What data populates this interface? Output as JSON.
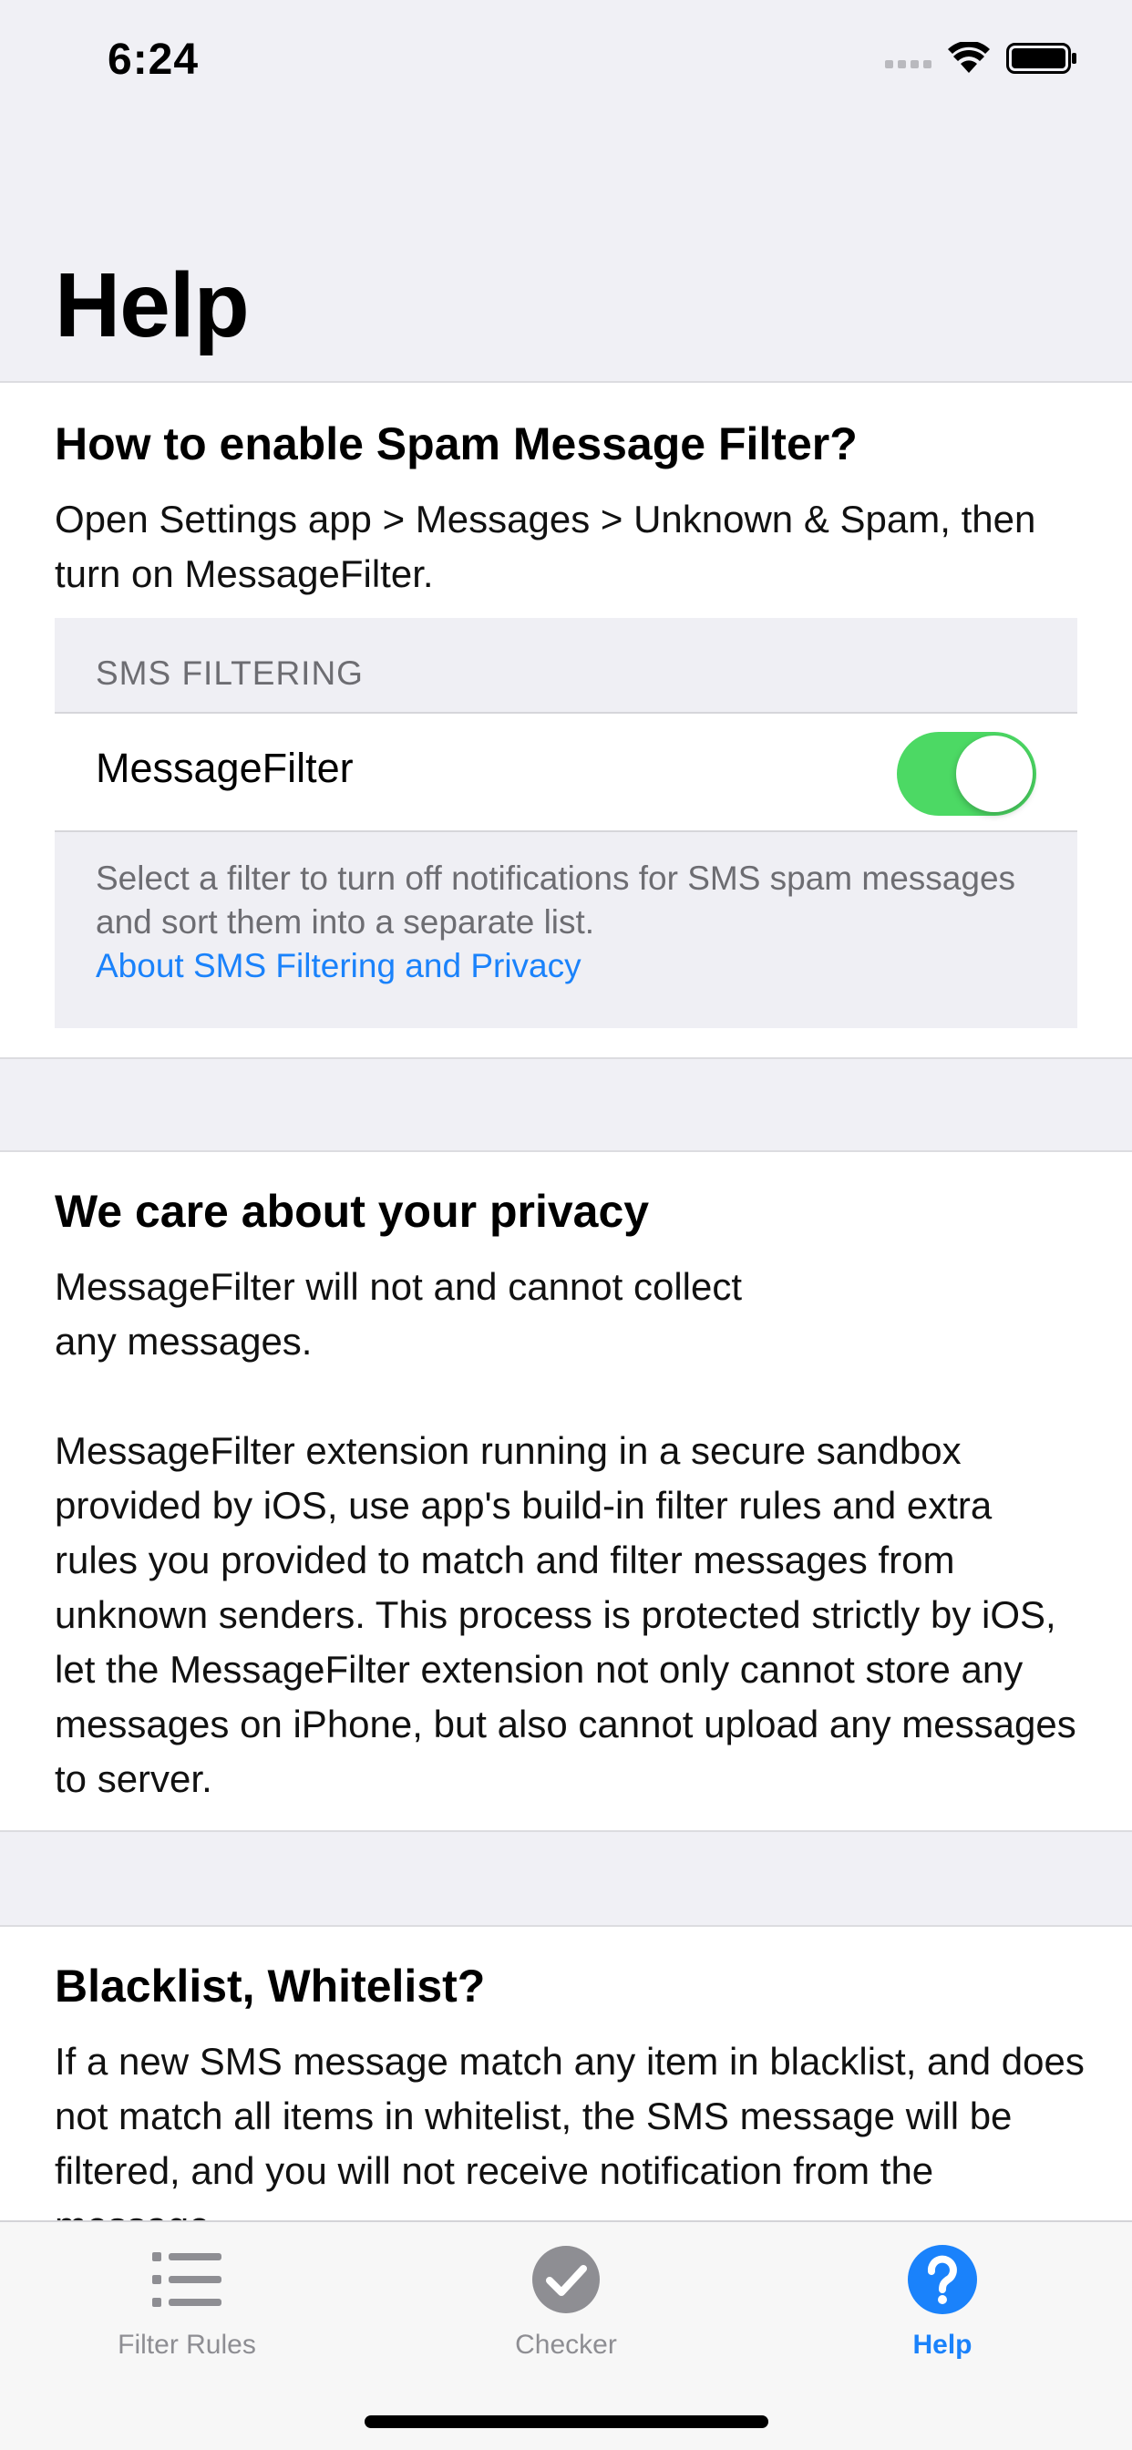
{
  "status_bar": {
    "time": "6:24"
  },
  "page_title": "Help",
  "sections": [
    {
      "title": "How to enable Spam Message Filter?",
      "body": "Open Settings app > Messages > Unknown & Spam, then turn on MessageFilter."
    },
    {
      "title": "We care about your privacy",
      "body": "MessageFilter will not and cannot collect\nany messages.\n\nMessageFilter extension running in a secure sandbox provided by iOS, use app's build-in filter rules and extra rules you provided to match and filter messages from unknown senders. This process is protected strictly by iOS, let the MessageFilter extension not only cannot store any messages on iPhone, but also cannot upload any messages to server."
    },
    {
      "title": "Blacklist, Whitelist?",
      "body": "If a new SMS message match any item in blacklist, and does not match all items in whitelist, the SMS message will be filtered, and you will not receive notification from the message."
    }
  ],
  "settings_preview": {
    "header": "SMS FILTERING",
    "row_label": "MessageFilter",
    "toggle_on": true,
    "footer_text": "Select a filter to turn off notifications for SMS spam messages and sort them into a separate list.",
    "footer_link": "About SMS Filtering and Privacy"
  },
  "tab_bar": {
    "tabs": [
      {
        "label": "Filter Rules",
        "icon": "list-icon",
        "active": false
      },
      {
        "label": "Checker",
        "icon": "checkmark-circle-icon",
        "active": false
      },
      {
        "label": "Help",
        "icon": "question-circle-icon",
        "active": true
      }
    ]
  },
  "colors": {
    "accent": "#1a82fb",
    "toggle_on": "#4cd964",
    "inactive_tab": "#8e8e93",
    "background": "#f0f0f5"
  }
}
